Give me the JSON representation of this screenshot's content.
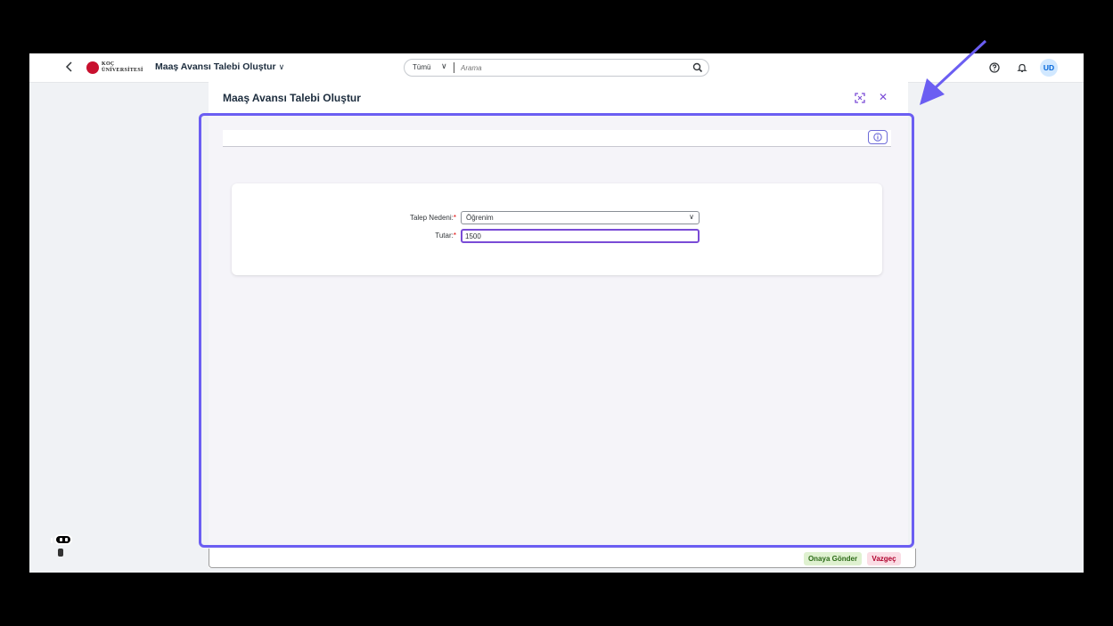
{
  "shell": {
    "back_icon": "chevron-left-icon",
    "logo_text_line1": "KOÇ",
    "logo_text_line2": "ÜNİVERSİTESİ",
    "app_title": "Maaş Avansı Talebi Oluştur",
    "search_scope": "Tümü",
    "search_placeholder": "Arama",
    "avatar_initials": "UD"
  },
  "dialog": {
    "title": "Maaş Avansı Talebi Oluştur",
    "form": {
      "reason_label": "Talep Nedeni:",
      "reason_value": "Öğrenim",
      "amount_label": "Tutar:",
      "amount_value": "1500",
      "required_marker": "*"
    },
    "footer": {
      "submit_label": "Onaya Gönder",
      "cancel_label": "Vazgeç"
    }
  },
  "colors": {
    "accent": "#7a4bd6",
    "highlight": "#6b5ef2",
    "submit_bg": "#dff1d0",
    "cancel_bg": "#fbdde5"
  }
}
